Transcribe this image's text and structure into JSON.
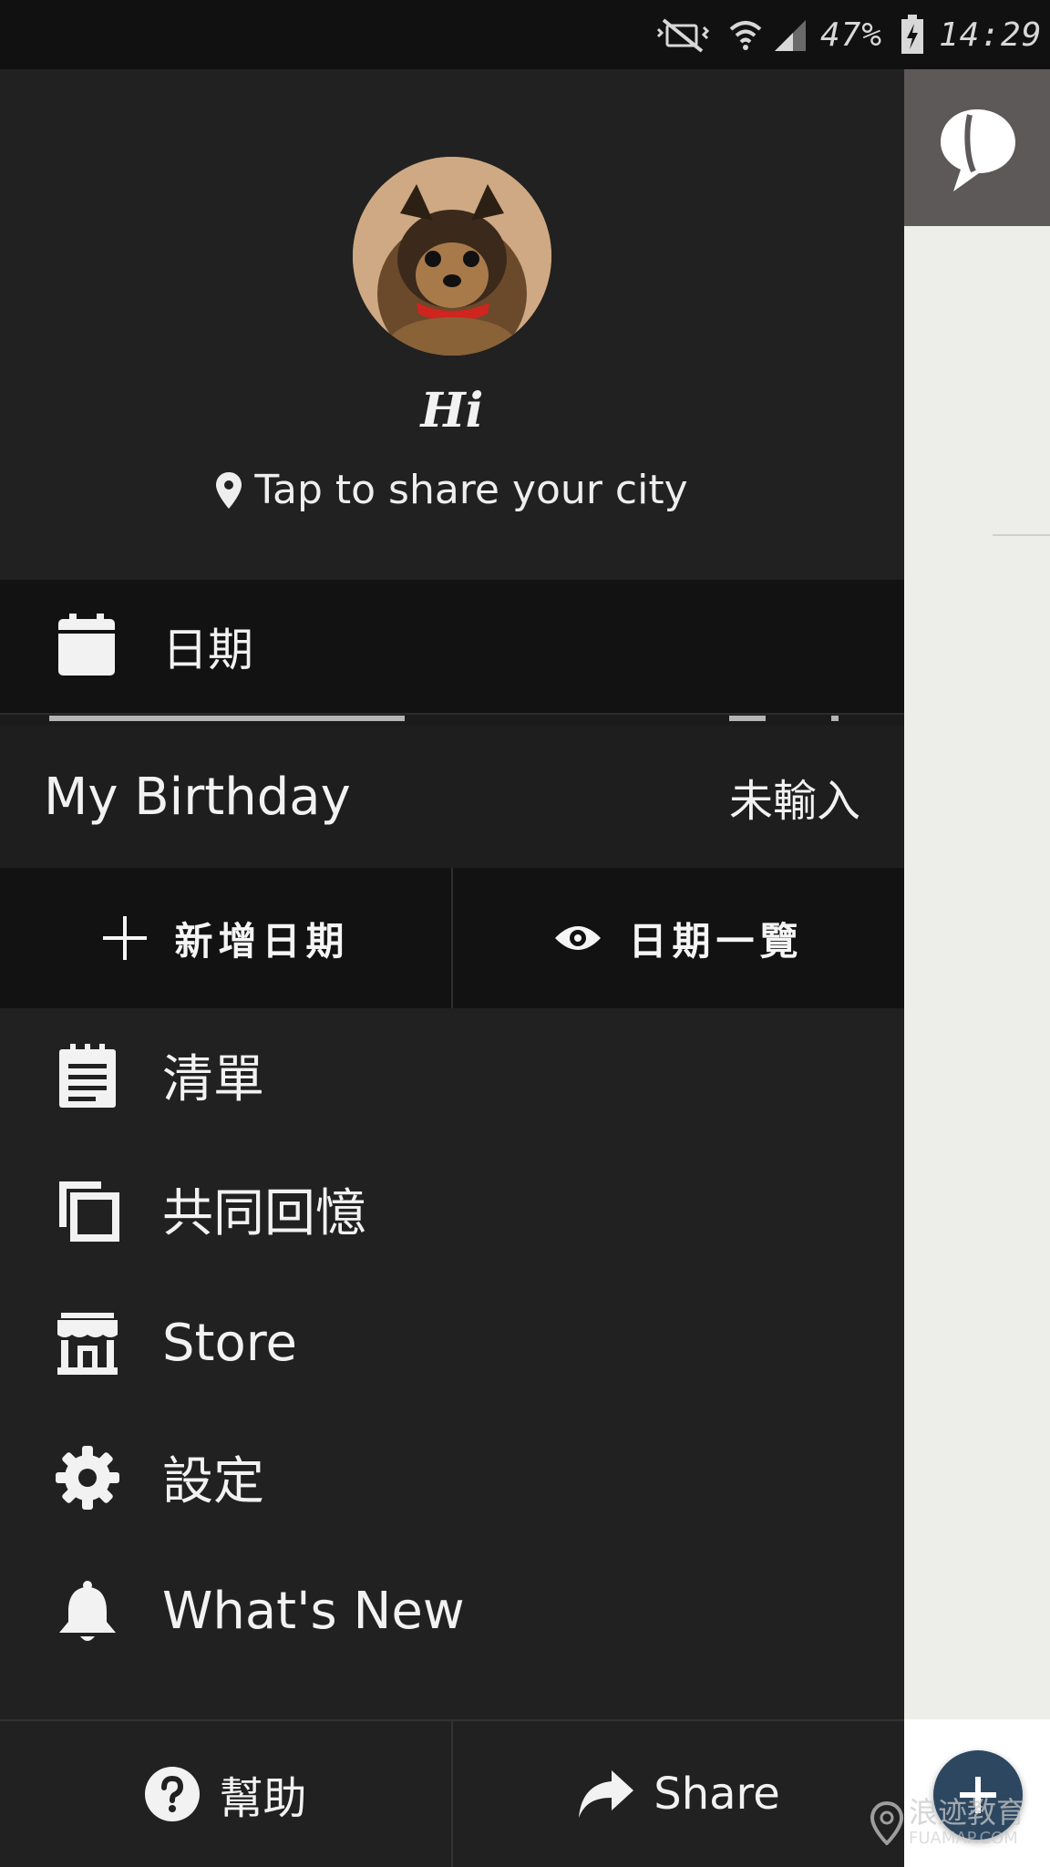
{
  "status_bar": {
    "battery": "47%",
    "time": "14:29",
    "icons": [
      "mute-vibrate-icon",
      "wifi-icon",
      "signal-icon",
      "battery-charging-icon"
    ]
  },
  "profile": {
    "greeting": "Hi",
    "city_prompt": "Tap to share your city",
    "location_icon": "location-pin-icon"
  },
  "dates": {
    "header_label": "日期",
    "header_icon": "calendar-icon",
    "entry_name": "My Birthday",
    "entry_value": "未輸入",
    "add_label": "新增日期",
    "list_label": "日期一覽"
  },
  "menu": {
    "items": [
      {
        "label": "清單",
        "icon": "notepad-icon"
      },
      {
        "label": "共同回憶",
        "icon": "copy-icon"
      },
      {
        "label": "Store",
        "icon": "store-icon"
      },
      {
        "label": "設定",
        "icon": "gear-icon"
      },
      {
        "label": "What's New",
        "icon": "bell-icon"
      }
    ]
  },
  "bottom": {
    "help_label": "幫助",
    "share_label": "Share"
  },
  "watermark": {
    "text": "浪迹教育",
    "sub": "FUAMAP.COM"
  },
  "colors": {
    "drawer_bg": "#212121",
    "section_dark": "#121212",
    "status_bar": "#111111",
    "fab": "#2d4760"
  }
}
